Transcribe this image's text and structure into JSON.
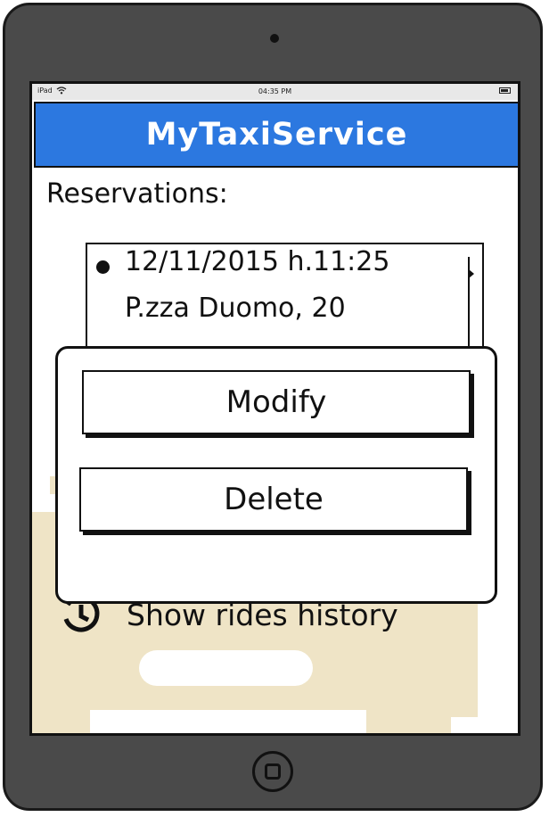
{
  "statusbar": {
    "device": "iPad",
    "time": "04:35 PM"
  },
  "app": {
    "title": "MyTaxiService"
  },
  "reservations": {
    "heading": "Reservations:",
    "items": [
      {
        "datetime": "12/11/2015 h.11:25",
        "address": "P.zza Duomo, 20"
      }
    ]
  },
  "popover": {
    "modify_label": "Modify",
    "delete_label": "Delete"
  },
  "history": {
    "label": "Show rides history"
  },
  "colors": {
    "accent": "#2c78e0",
    "car_bg": "#efe4c6"
  }
}
